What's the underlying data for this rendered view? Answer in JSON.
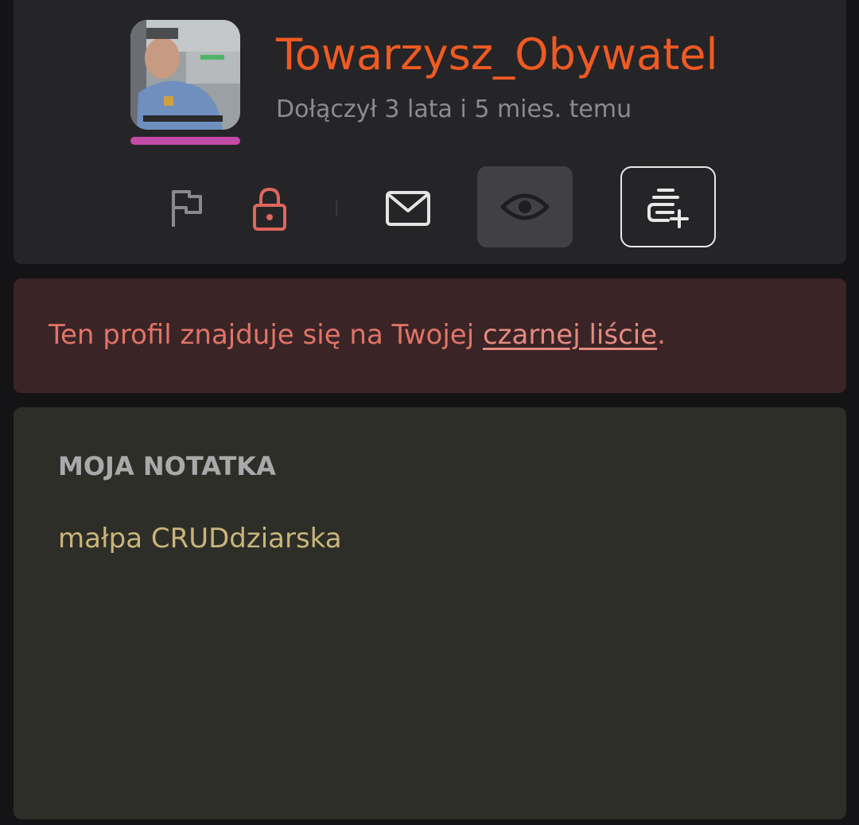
{
  "profile": {
    "username": "Towarzysz_Obywatel",
    "joined": "Dołączył 3 lata i 5 mies. temu"
  },
  "actions": {
    "icons": [
      "flag-icon",
      "lock-icon",
      "mail-icon",
      "eye-icon",
      "add-note-icon"
    ]
  },
  "blacklist": {
    "text_before": "Ten profil znajduje się na Twojej ",
    "link": "czarnej liście",
    "text_after": "."
  },
  "note": {
    "title": "MOJA NOTATKA",
    "text": "małpa CRUDdziarska"
  },
  "colors": {
    "username": "#f05a22",
    "avatar_bar": "#c44aa8",
    "blacklist_text": "#e07468",
    "note_text": "#c9b57a"
  }
}
